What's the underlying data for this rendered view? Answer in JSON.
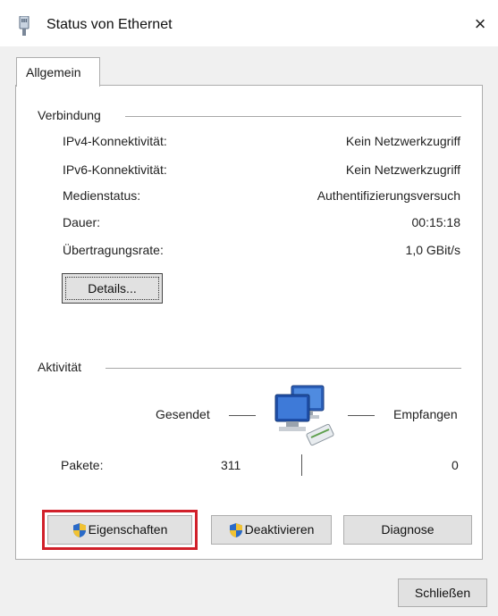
{
  "window": {
    "title": "Status von Ethernet",
    "close_symbol": "×"
  },
  "tabs": [
    {
      "label": "Allgemein",
      "selected": true
    }
  ],
  "connection": {
    "group_title": "Verbindung",
    "rows": [
      {
        "label": "IPv4-Konnektivität:",
        "value": "Kein Netzwerkzugriff"
      },
      {
        "label": "IPv6-Konnektivität:",
        "value": "Kein Netzwerkzugriff"
      },
      {
        "label": "Medienstatus:",
        "value": "Authentifizierungsversuch"
      },
      {
        "label": "Dauer:",
        "value": "00:15:18"
      },
      {
        "label": "Übertragungsrate:",
        "value": "1,0 GBit/s"
      }
    ],
    "details_button": "Details..."
  },
  "activity": {
    "group_title": "Aktivität",
    "sent_label": "Gesendet",
    "received_label": "Empfangen",
    "packets_label": "Pakete:",
    "packets_sent": "311",
    "packets_received": "0",
    "icon": "network-computers-icon"
  },
  "buttons": {
    "properties": "Eigenschaften",
    "deactivate": "Deaktivieren",
    "diagnose": "Diagnose",
    "close": "Schließen"
  },
  "colors": {
    "highlight_border": "#d1202a",
    "button_bg": "#e1e1e1"
  }
}
